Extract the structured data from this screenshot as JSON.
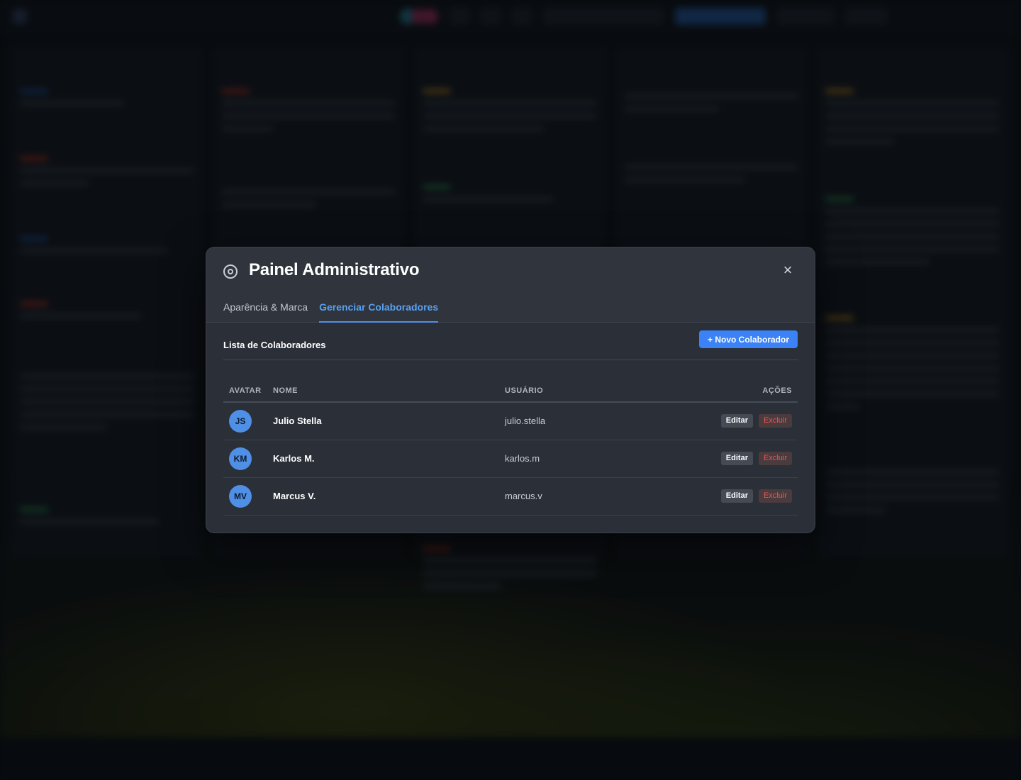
{
  "modal": {
    "title": "Painel Administrativo",
    "icon": "gear-icon",
    "close_icon": "close-icon",
    "close_label": "×"
  },
  "tabs": [
    {
      "label": "Aparência & Marca",
      "active": false
    },
    {
      "label": "Gerenciar Colaboradores",
      "active": true
    }
  ],
  "list": {
    "title": "Lista de Colaboradores",
    "new_button": "+ Novo Colaborador",
    "columns": {
      "avatar": "AVATAR",
      "name": "NOME",
      "user": "USUÁRIO",
      "actions": "AÇÕES"
    },
    "rows": [
      {
        "initials": "JS",
        "name": "Julio Stella",
        "username": "julio.stella",
        "edit": "Editar",
        "delete": "Excluir"
      },
      {
        "initials": "KM",
        "name": "Karlos M.",
        "username": "karlos.m",
        "edit": "Editar",
        "delete": "Excluir"
      },
      {
        "initials": "MV",
        "name": "Marcus V.",
        "username": "marcus.v",
        "edit": "Editar",
        "delete": "Excluir"
      }
    ]
  },
  "colors": {
    "accent": "#3b82f6",
    "avatar": "#4f8fe6",
    "danger": "#ef5350",
    "modal_bg": "#2b3038"
  }
}
